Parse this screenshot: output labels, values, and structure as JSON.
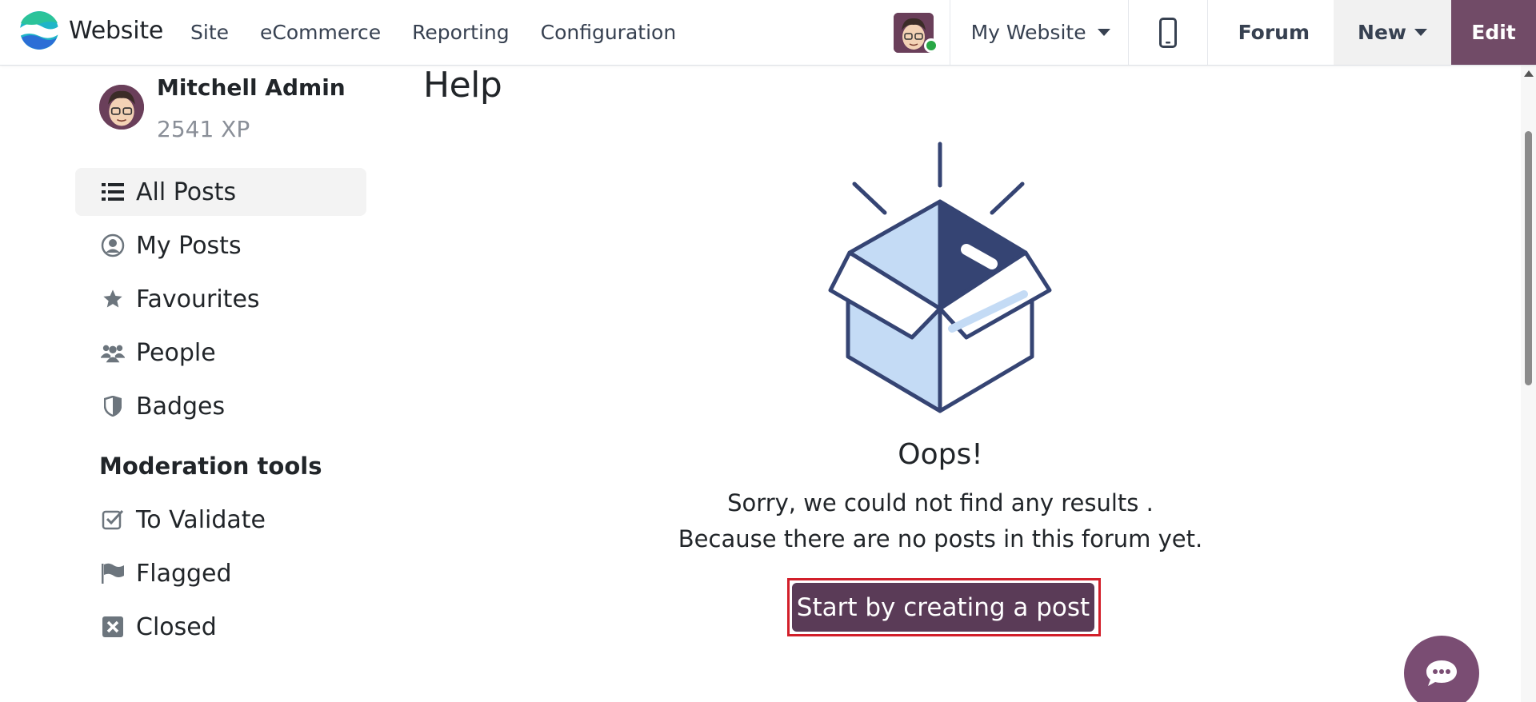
{
  "navbar": {
    "brand": "Website",
    "menu": [
      "Site",
      "eCommerce",
      "Reporting",
      "Configuration"
    ],
    "website_selector": "My Website",
    "forum_link": "Forum",
    "new_button": "New",
    "edit_button": "Edit"
  },
  "sidebar": {
    "user_name": "Mitchell Admin",
    "user_xp": "2541 XP",
    "items": [
      {
        "label": "All Posts",
        "icon": "list-icon",
        "active": true
      },
      {
        "label": "My Posts",
        "icon": "user-circle-icon",
        "active": false
      },
      {
        "label": "Favourites",
        "icon": "star-icon",
        "active": false
      },
      {
        "label": "People",
        "icon": "people-icon",
        "active": false
      },
      {
        "label": "Badges",
        "icon": "shield-icon",
        "active": false
      }
    ],
    "moderation_title": "Moderation tools",
    "moderation_items": [
      {
        "label": "To Validate",
        "icon": "checkbox-icon"
      },
      {
        "label": "Flagged",
        "icon": "flag-icon"
      },
      {
        "label": "Closed",
        "icon": "close-box-icon"
      }
    ]
  },
  "main": {
    "title": "Help",
    "empty_title": "Oops!",
    "empty_line1": "Sorry, we could not find any results .",
    "empty_line2": "Because there are no posts in this forum yet.",
    "cta_label": "Start by creating a post"
  },
  "colors": {
    "brand_purple": "#714b67",
    "cta_purple": "#5a3b57",
    "highlight_red": "#d21f2a",
    "box_navy": "#354473",
    "box_light": "#c4dbf5"
  }
}
